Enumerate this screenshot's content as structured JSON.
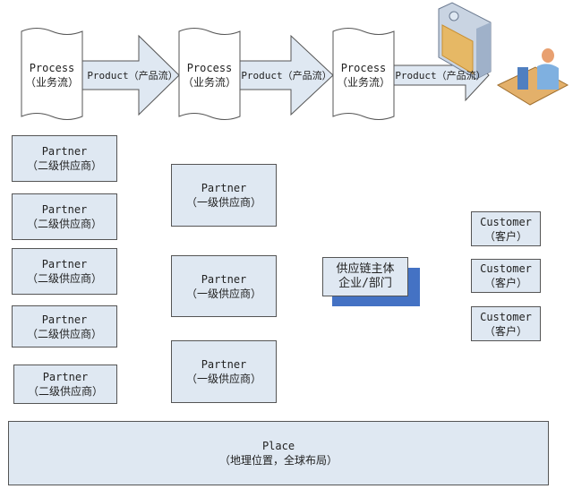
{
  "process_flow": {
    "processes": [
      {
        "title": "Process",
        "subtitle": "（业务流）"
      },
      {
        "title": "Process",
        "subtitle": "（业务流）"
      },
      {
        "title": "Process",
        "subtitle": "（业务流）"
      }
    ],
    "arrows": [
      "Product（产品流）",
      "Product（产品流）",
      "Product（产品流）"
    ],
    "end_icons": [
      "server-icon",
      "user-at-computer-icon"
    ]
  },
  "secondary_partners": [
    {
      "title": "Partner",
      "subtitle": "（二级供应商）"
    },
    {
      "title": "Partner",
      "subtitle": "（二级供应商）"
    },
    {
      "title": "Partner",
      "subtitle": "（二级供应商）"
    },
    {
      "title": "Partner",
      "subtitle": "（二级供应商）"
    },
    {
      "title": "Partner",
      "subtitle": "（二级供应商）"
    }
  ],
  "primary_partners": [
    {
      "title": "Partner",
      "subtitle": "（一级供应商）"
    },
    {
      "title": "Partner",
      "subtitle": "（一级供应商）"
    },
    {
      "title": "Partner",
      "subtitle": "（一级供应商）"
    }
  ],
  "core": {
    "line1": "供应链主体",
    "line2": "企业/部门"
  },
  "customers": [
    {
      "title": "Customer",
      "subtitle": "（客户）"
    },
    {
      "title": "Customer",
      "subtitle": "（客户）"
    },
    {
      "title": "Customer",
      "subtitle": "（客户）"
    }
  ],
  "place": {
    "title": "Place",
    "subtitle": "（地理位置，全球布局）"
  },
  "colors": {
    "box_fill": "#dfe8f2",
    "shadow": "#4472c4",
    "border": "#555555"
  }
}
